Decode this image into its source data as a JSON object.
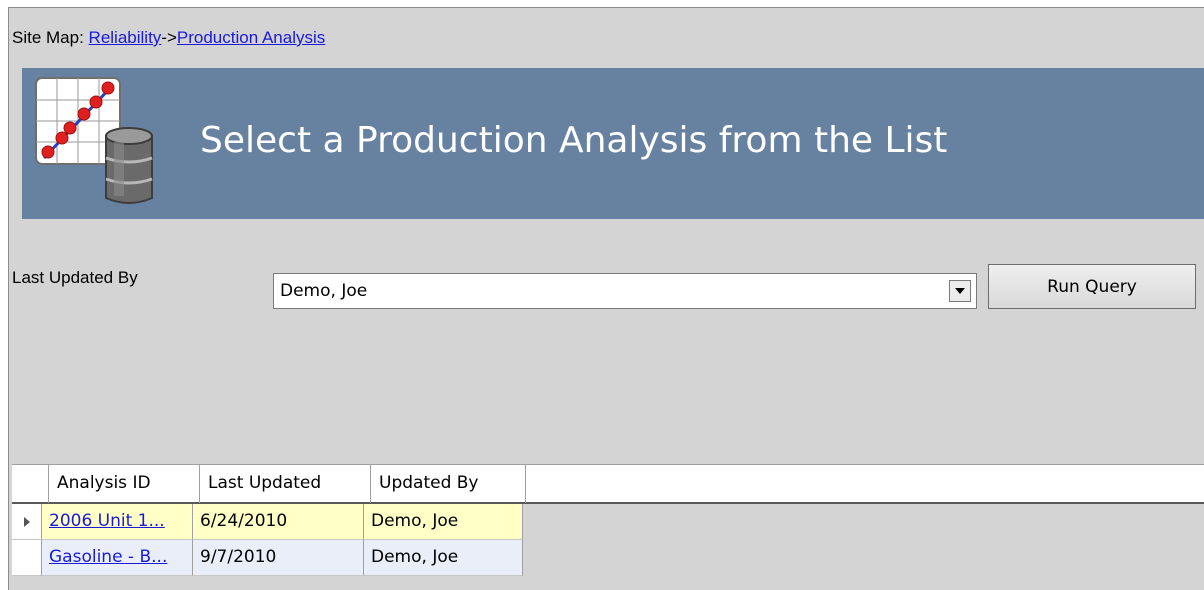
{
  "sitemap": {
    "prefix": "Site Map: ",
    "links": [
      "Reliability",
      "Production Analysis"
    ],
    "separator": "->"
  },
  "banner": {
    "title": "Select a Production Analysis from the List",
    "icon": "chart-barrel-icon"
  },
  "filter": {
    "label": "Last Updated By",
    "selected": "Demo, Joe",
    "run_label": "Run Query"
  },
  "grid": {
    "columns": [
      "Analysis ID",
      "Last Updated",
      "Updated By"
    ],
    "rows": [
      {
        "analysis_id": "2006 Unit 1...",
        "last_updated": "6/24/2010",
        "updated_by": "Demo, Joe"
      },
      {
        "analysis_id": "Gasoline - B...",
        "last_updated": "9/7/2010",
        "updated_by": "Demo, Joe"
      }
    ]
  },
  "colors": {
    "banner_bg": "#6781a1",
    "panel_bg": "#d4d4d4",
    "link": "#1a1adb",
    "selected_row": "#ffffc6",
    "alt_row": "#e9eef8"
  }
}
